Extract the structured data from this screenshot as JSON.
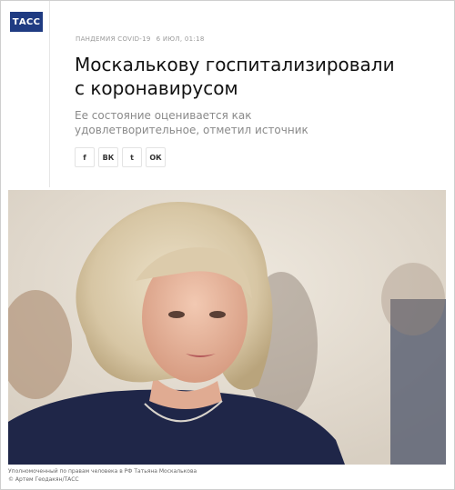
{
  "brand": {
    "logo_text": "ТАСС",
    "color": "#1f3b82"
  },
  "article": {
    "rubric": "ПАНДЕМИЯ COVID-19",
    "date": "6 ИЮЛ, 01:18",
    "title": "Москалькову госпитализировали с коронавирусом",
    "lead": "Ее состояние оценивается как удовлетворительное, отметил источник"
  },
  "share": [
    {
      "label": "f",
      "icon": "facebook-icon"
    },
    {
      "label": "ВК",
      "icon": "vk-icon"
    },
    {
      "label": "t",
      "icon": "twitter-icon"
    },
    {
      "label": "ОК",
      "icon": "odnoklassniki-icon"
    }
  ],
  "photo": {
    "caption": "Уполномоченный по правам человека в РФ Татьяна Москалькова",
    "credit": "© Артем Геодакян/ТАСС"
  }
}
